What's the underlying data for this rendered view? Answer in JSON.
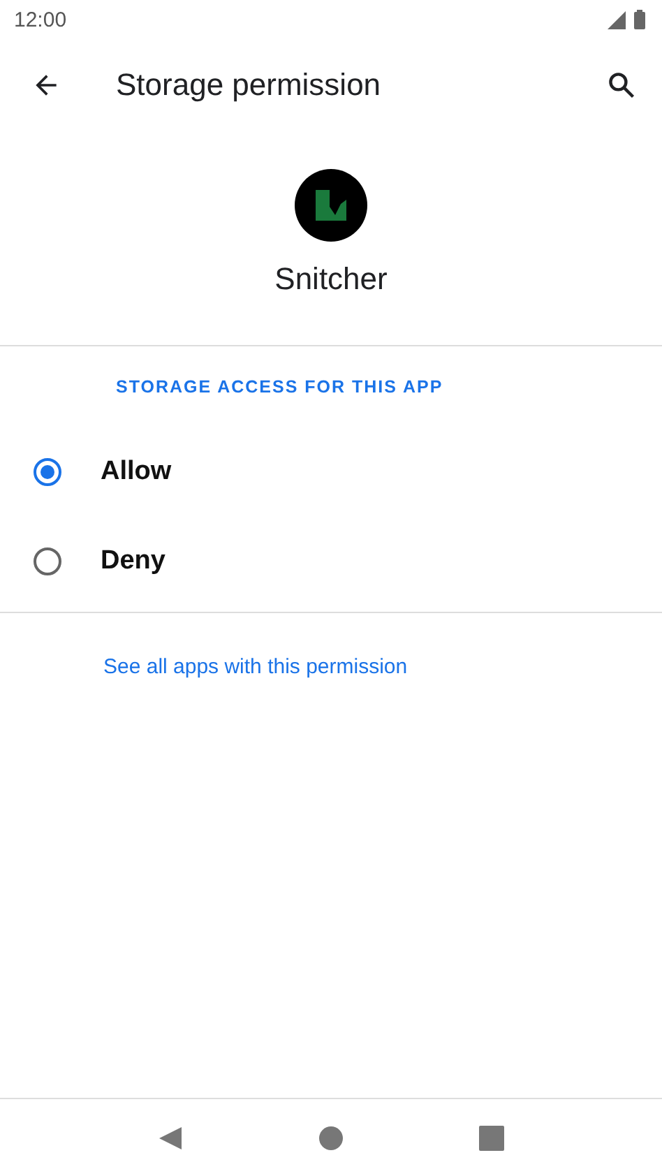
{
  "status_bar": {
    "time": "12:00"
  },
  "toolbar": {
    "title": "Storage permission"
  },
  "app": {
    "name": "Snitcher"
  },
  "section": {
    "header": "STORAGE ACCESS FOR THIS APP"
  },
  "options": [
    {
      "label": "Allow",
      "selected": true
    },
    {
      "label": "Deny",
      "selected": false
    }
  ],
  "link": "See all apps with this permission"
}
